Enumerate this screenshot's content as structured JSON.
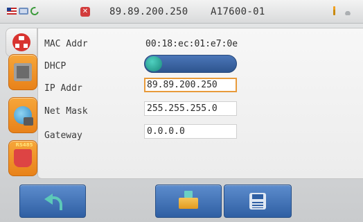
{
  "statusbar": {
    "ip": "89.89.200.250",
    "device_id": "A17600-01",
    "icons": [
      "flag-icon",
      "network-icon",
      "link-icon",
      "close-icon",
      "battery-icon",
      "signal-icon"
    ],
    "close_glyph": "✕"
  },
  "sidebar": {
    "items": [
      {
        "name": "network-tree",
        "icon": "network-tree-icon",
        "active": true
      },
      {
        "name": "ethernet-port",
        "icon": "ethernet-port-icon",
        "active": false
      },
      {
        "name": "globe-ethernet",
        "icon": "globe-ethernet-icon",
        "active": false
      },
      {
        "name": "serial-port",
        "icon": "serial-port-icon",
        "label": "RS485",
        "active": false
      }
    ]
  },
  "form": {
    "mac_label": "MAC Addr",
    "mac_value": "00:18:ec:01:e7:0e",
    "dhcp_label": "DHCP",
    "dhcp_enabled": false,
    "ip_label": "IP Addr",
    "ip_value": "89.89.200.250",
    "mask_label": "Net Mask",
    "mask_value": "255.255.255.0",
    "gateway_label": "Gateway",
    "gateway_value": "0.0.0.0"
  },
  "toolbar": {
    "buttons": [
      {
        "name": "back-button",
        "icon": "back-arrow-icon"
      },
      {
        "name": "open-button",
        "icon": "open-folder-icon"
      },
      {
        "name": "save-button",
        "icon": "save-disk-icon"
      }
    ]
  },
  "colors": {
    "accent_orange": "#e8821a",
    "button_blue": "#2f5fa3",
    "toggle_knob": "#1a8a7c",
    "focus_border": "#e89a3a"
  }
}
